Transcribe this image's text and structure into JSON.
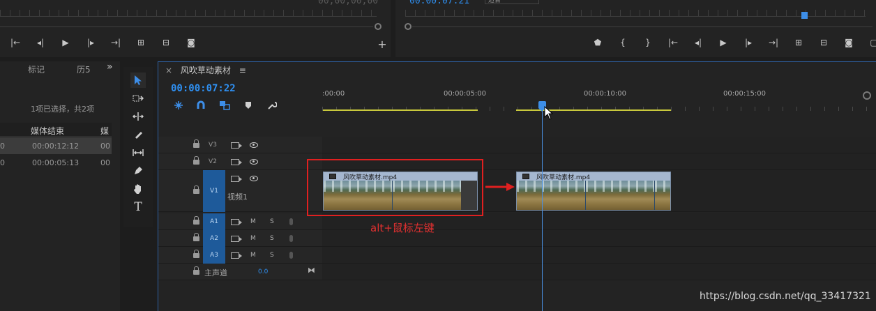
{
  "source_monitor": {
    "timecode": "00;00;00;00"
  },
  "program_monitor": {
    "timecode": "00:00:07:21",
    "fit_label": "适合"
  },
  "project_panel": {
    "tabs": [
      "标记",
      "历5"
    ],
    "overflow": "»",
    "selection_info": "1项已选择，共2项",
    "columns": [
      "媒体结束",
      "媒"
    ],
    "rows": [
      {
        "lead": "0",
        "media_end": "00:00:12:12",
        "trail": "00"
      },
      {
        "lead": "0",
        "media_end": "00:00:05:13",
        "trail": "00"
      }
    ]
  },
  "timeline": {
    "close_glyph": "×",
    "sequence_name": "风吹草动素材",
    "menu_glyph": "≡",
    "timecode": "00:00:07:22",
    "ruler_labels": [
      ":00:00",
      "00:00:05:00",
      "00:00:10:00",
      "00:00:15:00"
    ],
    "video_tracks": [
      "V3",
      "V2",
      "V1"
    ],
    "v1_label": "视频1",
    "audio_tracks": [
      "A1",
      "A2",
      "A3"
    ],
    "mute_label": "M",
    "solo_label": "S",
    "master": {
      "label": "主声道",
      "value": "0.0"
    },
    "clips": [
      {
        "name": "风吹草动素材.mp4"
      },
      {
        "name": "风吹草动素材.mp4"
      }
    ]
  },
  "annotation": {
    "text": "alt+鼠标左键",
    "color": "#e03030"
  },
  "watermark": "https://blog.csdn.net/qq_33417321",
  "colors": {
    "accent": "#2f8ff0",
    "target_track": "#1e5a9a",
    "work_area": "#c8c83c"
  }
}
